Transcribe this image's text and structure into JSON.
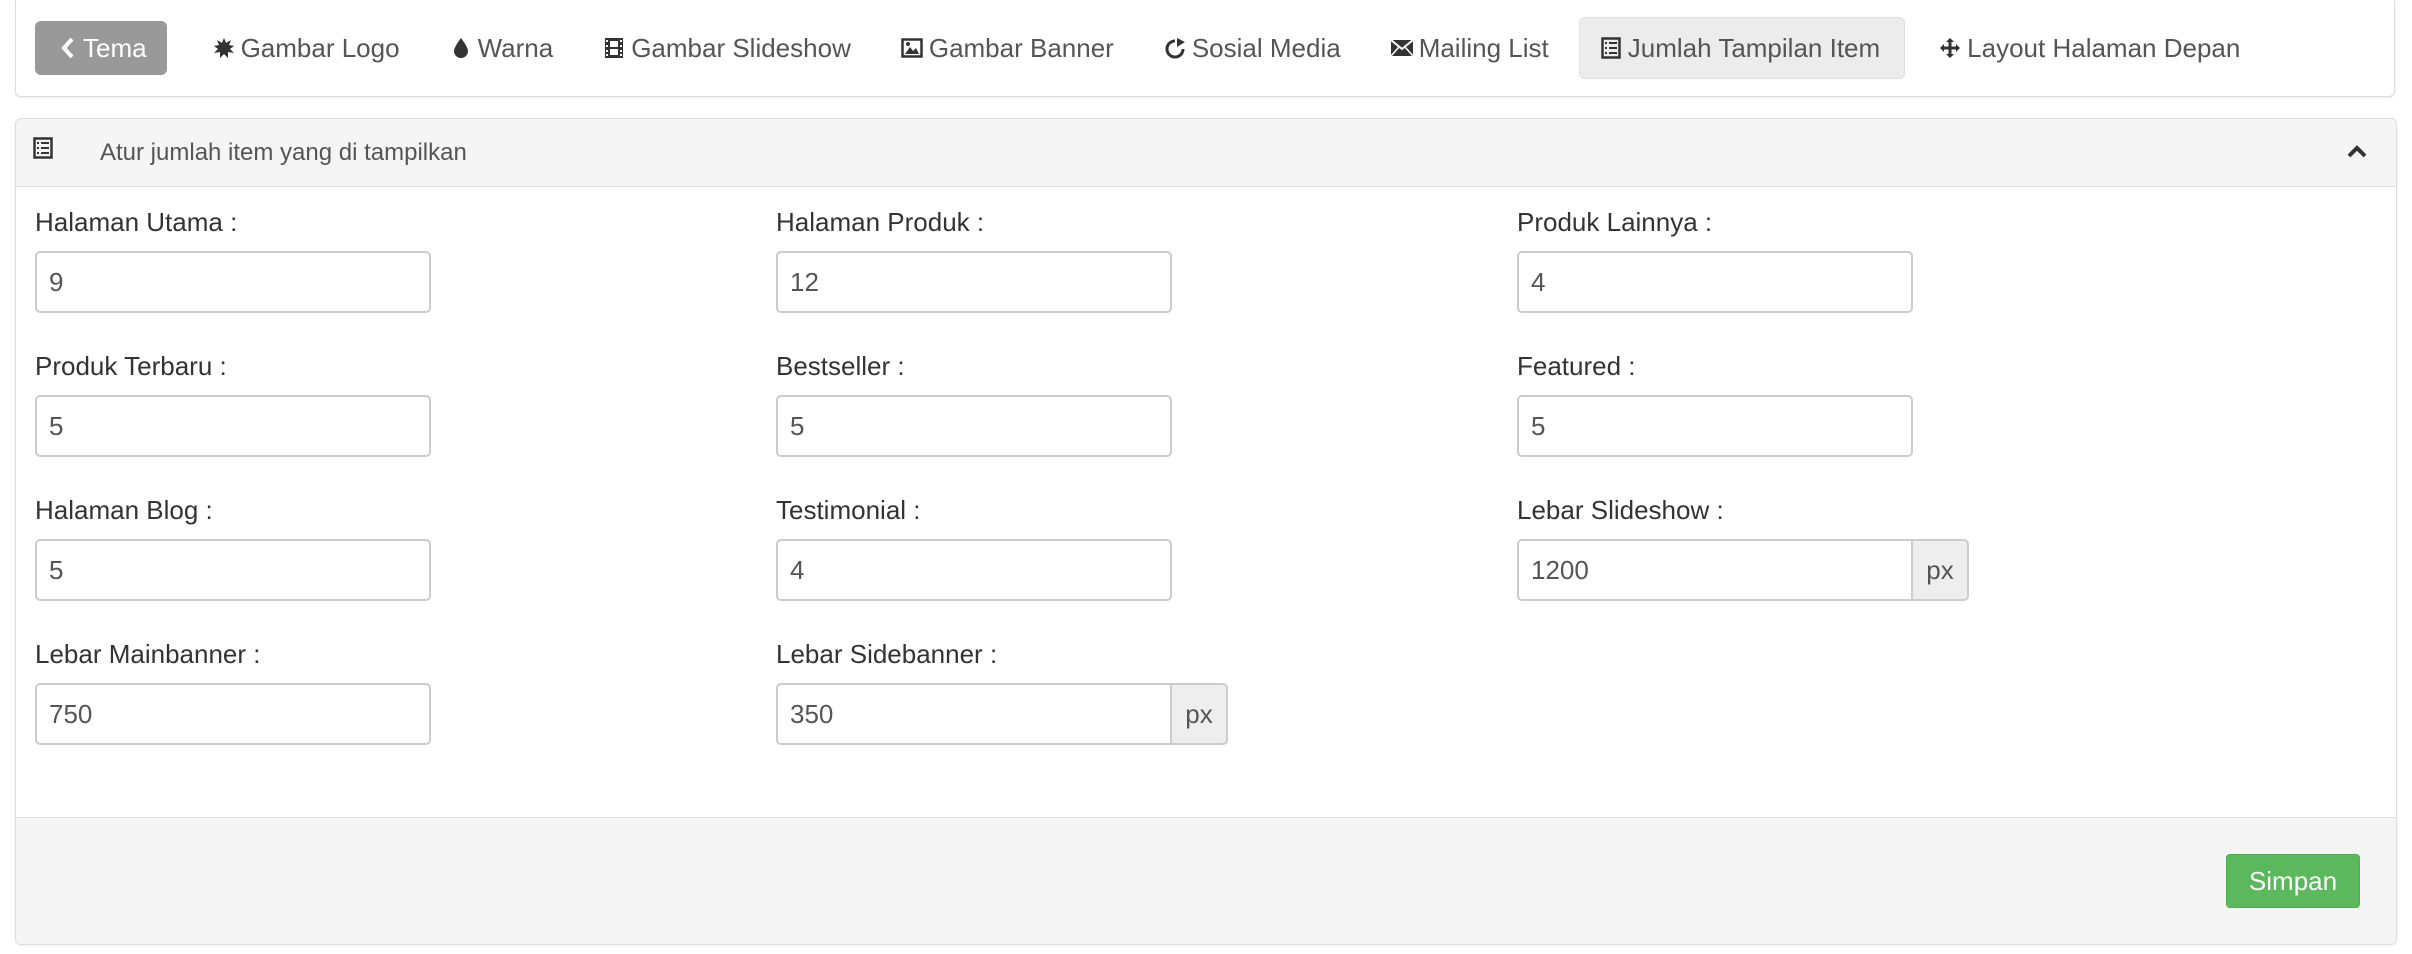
{
  "nav": {
    "back": {
      "label": "Tema",
      "icon": "chevron-left-icon"
    },
    "tabs": [
      {
        "label": "Gambar Logo",
        "icon": "certificate-icon"
      },
      {
        "label": "Warna",
        "icon": "tint-icon"
      },
      {
        "label": "Gambar Slideshow",
        "icon": "film-icon"
      },
      {
        "label": "Gambar Banner",
        "icon": "picture-icon"
      },
      {
        "label": "Sosial Media",
        "icon": "share-icon"
      },
      {
        "label": "Mailing List",
        "icon": "envelope-icon"
      },
      {
        "label": "Jumlah Tampilan Item",
        "icon": "list-alt-icon",
        "active": true
      },
      {
        "label": "Layout Halaman Depan",
        "icon": "move-icon"
      }
    ]
  },
  "panel": {
    "title": "Atur jumlah item yang di tampilkan",
    "icon": "list-alt-icon",
    "collapse_icon": "chevron-up-icon"
  },
  "fields": {
    "halaman_utama": {
      "label": "Halaman Utama :",
      "value": "9"
    },
    "halaman_produk": {
      "label": "Halaman Produk :",
      "value": "12"
    },
    "produk_lainnya": {
      "label": "Produk Lainnya :",
      "value": "4"
    },
    "produk_terbaru": {
      "label": "Produk Terbaru :",
      "value": "5"
    },
    "bestseller": {
      "label": "Bestseller :",
      "value": "5"
    },
    "featured": {
      "label": "Featured :",
      "value": "5"
    },
    "halaman_blog": {
      "label": "Halaman Blog :",
      "value": "5"
    },
    "testimonial": {
      "label": "Testimonial :",
      "value": "4"
    },
    "lebar_slideshow": {
      "label": "Lebar Slideshow :",
      "value": "1200",
      "unit": "px"
    },
    "lebar_mainbanner": {
      "label": "Lebar Mainbanner :",
      "value": "750"
    },
    "lebar_sidebanner": {
      "label": "Lebar Sidebanner :",
      "value": "350",
      "unit": "px"
    }
  },
  "footer": {
    "save_label": "Simpan"
  },
  "colors": {
    "save_button": "#5cb85c",
    "back_tab": "#999999",
    "active_tab": "#ececec"
  }
}
